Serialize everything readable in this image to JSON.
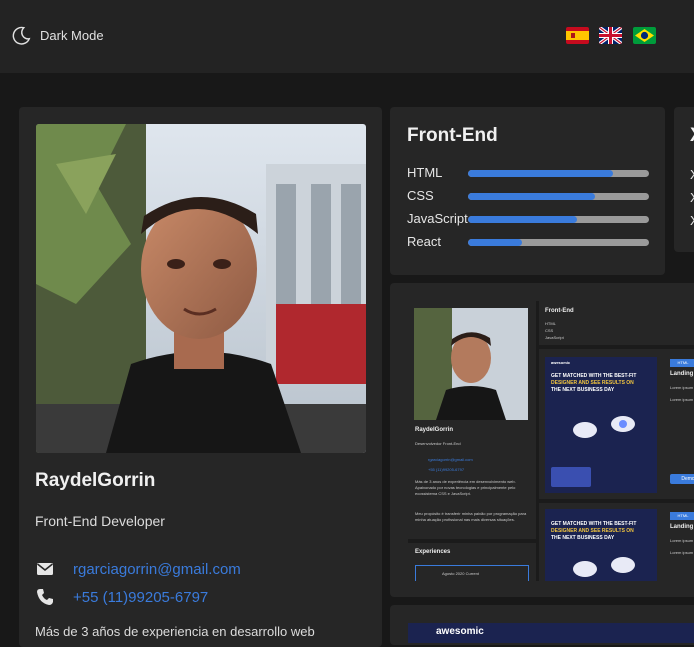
{
  "header": {
    "mode_label": "Dark Mode",
    "mode_icon": "moon-icon",
    "languages": [
      {
        "name": "spain-flag-icon"
      },
      {
        "name": "uk-flag-icon"
      },
      {
        "name": "brazil-flag-icon"
      }
    ]
  },
  "profile": {
    "name": "RaydelGorrin",
    "role": "Front-End Developer",
    "email": "rgarciagorrin@gmail.com",
    "phone": "+55 (11)99205-6797",
    "bio": "Más de 3 años de experiencia en desarrollo web"
  },
  "skills": {
    "title": "Front-End",
    "items": [
      {
        "label": "HTML",
        "level": 0.8
      },
      {
        "label": "CSS",
        "level": 0.7
      },
      {
        "label": "JavaScript",
        "level": 0.6
      },
      {
        "label": "React",
        "level": 0.3
      }
    ]
  },
  "side_panel": {
    "title": "X",
    "items": [
      "X",
      "X",
      "X"
    ]
  },
  "preview": {
    "name": "RaydelGorrin",
    "role": "Desenvolvedor Front-End",
    "email": "rgarciagorrin@gmail.com",
    "phone": "+55 (11)99205-6797",
    "skills_title": "Front-End",
    "skills": [
      "HTML",
      "CSS",
      "JavaScript"
    ],
    "bio": "Más de 3 anos de experiência em desenvolvimento web. Apaixonado por novas tecnologias e principalmente pelo ecossistema CSS e JavaScript.",
    "bio2": "Meu propósito é transferir minha paixão por programação para minha atuação profissional nas mais diversas situações.",
    "experiences_title": "Experiences",
    "experience_item": "Agosto 2020 Current",
    "brand": "awesomic",
    "headline1": "GET MATCHED WITH THE BEST-FIT",
    "headline2": "DESIGNER AND SEE RESULTS ON",
    "headline3": "THE NEXT BUSINESS DAY",
    "card_title": "Landing",
    "card_line": "Lorem ipsum",
    "card_button": "Demo",
    "card_tag": "HTML"
  },
  "colors": {
    "accent": "#3a7bdc",
    "background": "#181818",
    "panel": "#262626",
    "topbar": "#232323"
  }
}
